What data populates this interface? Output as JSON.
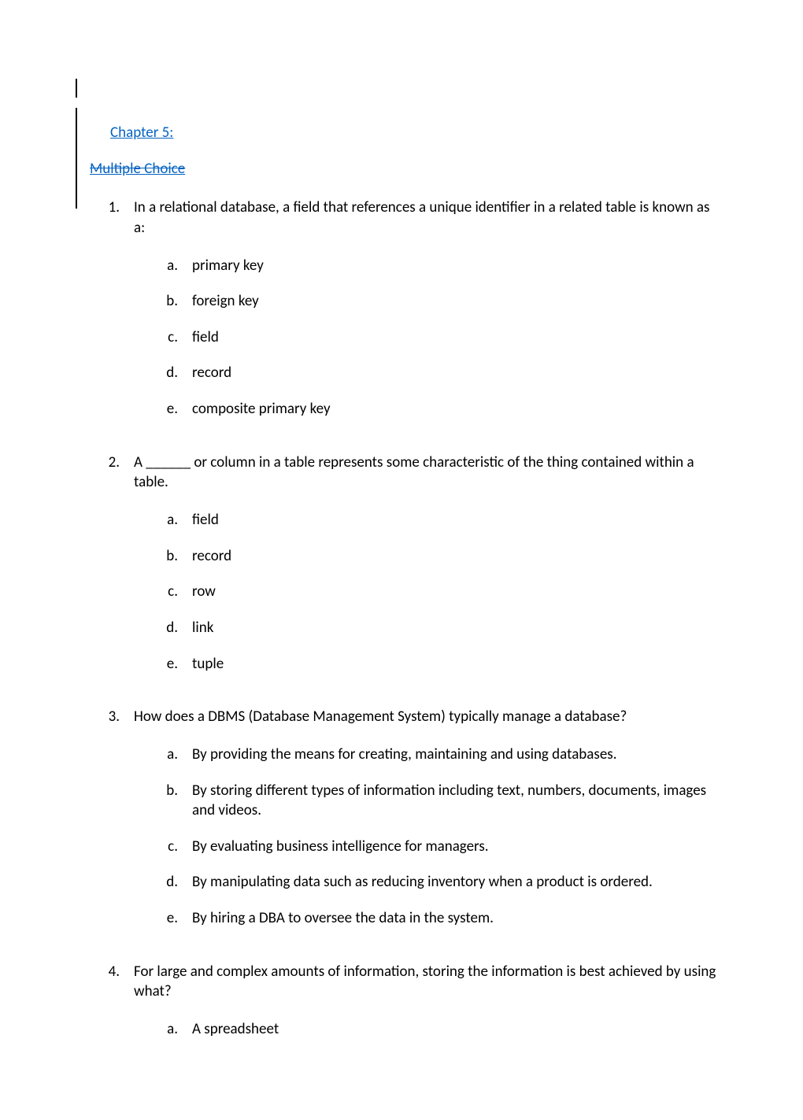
{
  "heading": {
    "chapter": "Chapter 5: ",
    "multiple_choice": "Multiple Choice"
  },
  "questions": [
    {
      "num": "1.",
      "text": "In a relational database, a field that references a unique identifier in a related table is known as a:",
      "options": [
        {
          "letter": "a.",
          "text": "primary key"
        },
        {
          "letter": "b.",
          "text": "foreign key"
        },
        {
          "letter": "c.",
          "text": "field"
        },
        {
          "letter": "d.",
          "text": "record"
        },
        {
          "letter": "e.",
          "text": "composite primary key"
        }
      ]
    },
    {
      "num": "2.",
      "text": "A ______ or column in a table represents some characteristic of the thing contained within a table.",
      "options": [
        {
          "letter": "a.",
          "text": "field"
        },
        {
          "letter": "b.",
          "text": "record"
        },
        {
          "letter": "c.",
          "text": "row"
        },
        {
          "letter": "d.",
          "text": "link"
        },
        {
          "letter": "e.",
          "text": "tuple"
        }
      ]
    },
    {
      "num": "3.",
      "text": "How does a DBMS (Database Management System) typically manage a database?",
      "options": [
        {
          "letter": "a.",
          "text": "By providing the means for creating, maintaining and using databases."
        },
        {
          "letter": "b.",
          "text": "By storing different types of information including text, numbers, documents, images and videos."
        },
        {
          "letter": "c.",
          "text": "By evaluating business intelligence for managers."
        },
        {
          "letter": "d.",
          "text": "By manipulating data such as reducing inventory when a product is ordered."
        },
        {
          "letter": "e.",
          "text": "By hiring a DBA to oversee the data in the system."
        }
      ]
    },
    {
      "num": "4.",
      "text": "For large and complex amounts of information, storing the information is best achieved by using what?",
      "options": [
        {
          "letter": "a.",
          "text": "A spreadsheet"
        }
      ]
    }
  ]
}
